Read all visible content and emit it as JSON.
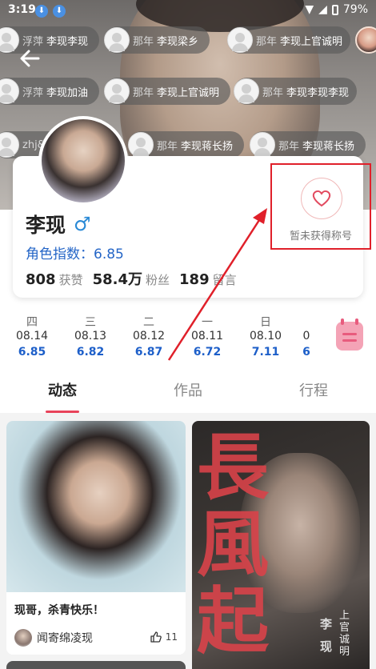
{
  "status_bar": {
    "time": "3:19",
    "battery": "79%"
  },
  "danmaku": [
    {
      "prefix": "浮萍",
      "text": "李现李现"
    },
    {
      "prefix": "那年",
      "text": "李现梁乡"
    },
    {
      "prefix": "那年",
      "text": "李现上官诚明"
    },
    {
      "prefix": "浮萍",
      "text": "李现加油"
    },
    {
      "prefix": "那年",
      "text": "李现上官诚明"
    },
    {
      "prefix": "那年",
      "text": "李现李现李现"
    },
    {
      "prefix": "zhj&lx",
      "text": ""
    },
    {
      "prefix": "那年",
      "text": "李现蒋长扬"
    },
    {
      "prefix": "那年",
      "text": "李现蒋长扬"
    }
  ],
  "profile": {
    "name": "李现",
    "gender_symbol": "♂",
    "index_label": "角色指数：6.85",
    "stats": [
      {
        "value": "808",
        "label": "获赞"
      },
      {
        "value": "58.4万",
        "label": "粉丝"
      },
      {
        "value": "189",
        "label": "留言"
      }
    ],
    "title_badge": "暂未获得称号"
  },
  "dates": [
    {
      "weekday": "四",
      "date": "08.14",
      "value": "6.85"
    },
    {
      "weekday": "三",
      "date": "08.13",
      "value": "6.82"
    },
    {
      "weekday": "二",
      "date": "08.12",
      "value": "6.87"
    },
    {
      "weekday": "一",
      "date": "08.11",
      "value": "6.72"
    },
    {
      "weekday": "日",
      "date": "08.10",
      "value": "7.11"
    },
    {
      "weekday": "",
      "date": "0",
      "value": "6"
    }
  ],
  "tabs": [
    "动态",
    "作品",
    "行程"
  ],
  "posts": [
    {
      "caption": "现哥，杀青快乐！",
      "author": "闻寄绵凌现",
      "likes": "11"
    },
    {
      "poster_title_chars": "長風起",
      "poster_name": "李现",
      "poster_role": "上官诚明"
    }
  ],
  "colors": {
    "accent": "#e8435a",
    "index_blue": "#2566c7",
    "highlight_box": "#e0202a"
  }
}
